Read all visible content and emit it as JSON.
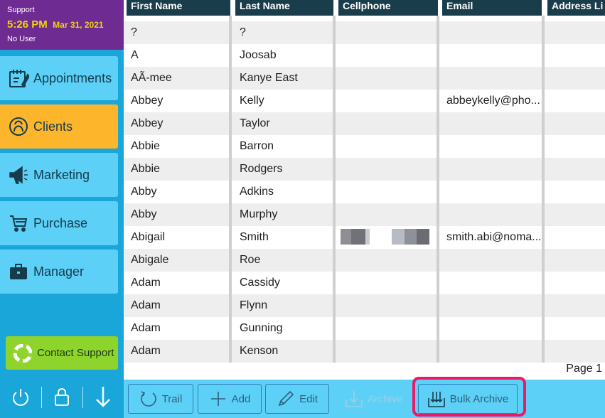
{
  "sidebar": {
    "user": {
      "role": "Support",
      "time": "5:26 PM",
      "date": "Mar 31, 2021",
      "user_name": "No User"
    },
    "nav": [
      {
        "label": "Appointments",
        "icon": "calendar-icon",
        "active": false
      },
      {
        "label": "Clients",
        "icon": "client-head-icon",
        "active": true
      },
      {
        "label": "Marketing",
        "icon": "megaphone-icon",
        "active": false
      },
      {
        "label": "Purchase",
        "icon": "cart-icon",
        "active": false
      },
      {
        "label": "Manager",
        "icon": "briefcase-icon",
        "active": false
      }
    ],
    "contact_support": "Contact Support"
  },
  "table": {
    "columns": [
      "First Name",
      "Last Name",
      "Cellphone",
      "Email",
      "Address Li"
    ],
    "rows": [
      {
        "first": "?",
        "last": "?",
        "cell": "",
        "email": ""
      },
      {
        "first": "A",
        "last": "Joosab",
        "cell": "",
        "email": ""
      },
      {
        "first": "AÃ-mee",
        "last": "Kanye East",
        "cell": "",
        "email": ""
      },
      {
        "first": "Abbey",
        "last": "Kelly",
        "cell": "",
        "email": "abbeykelly@pho..."
      },
      {
        "first": "Abbey",
        "last": "Taylor",
        "cell": "",
        "email": ""
      },
      {
        "first": "Abbie",
        "last": "Barron",
        "cell": "",
        "email": ""
      },
      {
        "first": "Abbie",
        "last": "Rodgers",
        "cell": "",
        "email": ""
      },
      {
        "first": "Abby",
        "last": "Adkins",
        "cell": "",
        "email": ""
      },
      {
        "first": "Abby",
        "last": "Murphy",
        "cell": "",
        "email": ""
      },
      {
        "first": "Abigail",
        "last": "Smith",
        "cell": "",
        "email": "smith.abi@noma..."
      },
      {
        "first": "Abigale",
        "last": "Roe",
        "cell": "",
        "email": ""
      },
      {
        "first": "Adam",
        "last": "Cassidy",
        "cell": "",
        "email": ""
      },
      {
        "first": "Adam",
        "last": "Flynn",
        "cell": "",
        "email": ""
      },
      {
        "first": "Adam",
        "last": "Gunning",
        "cell": "",
        "email": ""
      },
      {
        "first": "Adam",
        "last": "Kenson",
        "cell": "",
        "email": ""
      }
    ],
    "page_label": "Page 1"
  },
  "toolbar": {
    "trail": "Trail",
    "add": "Add",
    "edit": "Edit",
    "archive": "Archive",
    "bulk_archive": "Bulk Archive"
  },
  "colors": {
    "sidebar_bg": "#1aa6d8",
    "user_panel": "#6e2c93",
    "nav_button": "#5cd0f7",
    "nav_active": "#fdb52c",
    "header": "#1a3d4b",
    "contact_support": "#8fd42c",
    "highlight": "#ec1a64"
  }
}
